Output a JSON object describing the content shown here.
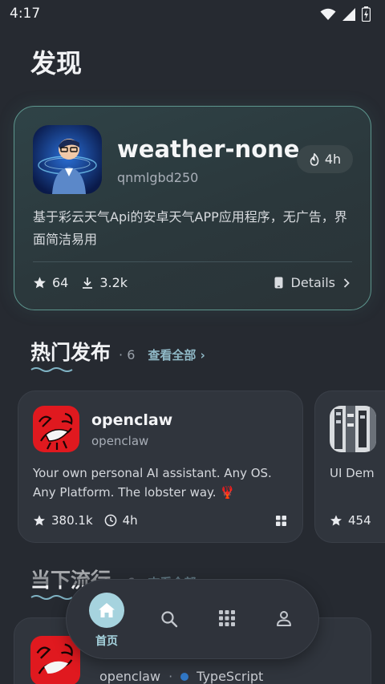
{
  "status_bar": {
    "time": "4:17"
  },
  "page": {
    "title": "发现"
  },
  "featured": {
    "name": "weather-none",
    "owner": "qnmlgbd250",
    "hot_time": "4h",
    "description": "基于彩云天气Api的安卓天气APP应用程序，无广告，界面简洁易用",
    "stars": "64",
    "downloads": "3.2k",
    "details_label": "Details"
  },
  "hot_section": {
    "title": "热门发布",
    "count": "· 6",
    "view_all": "查看全部 ›",
    "cards": [
      {
        "name": "openclaw",
        "owner": "openclaw",
        "description": "Your own personal AI assistant. Any OS. Any Platform. The lobster way. 🦞",
        "stars": "380.1k",
        "time": "4h"
      },
      {
        "name": "",
        "owner": "",
        "description": "UI Dem",
        "stars": "454",
        "time": ""
      }
    ]
  },
  "trending_section": {
    "title": "当下流行",
    "count": "· 6",
    "view_all": "查看全部 ›",
    "card": {
      "owner": "openclaw",
      "language": "TypeScript",
      "language_color": "#3178c6"
    }
  },
  "bottom_nav": {
    "home_label": "首页"
  },
  "colors": {
    "accent": "#a6d3de",
    "featured_border": "#5d958d",
    "link": "#8fb8c6"
  }
}
